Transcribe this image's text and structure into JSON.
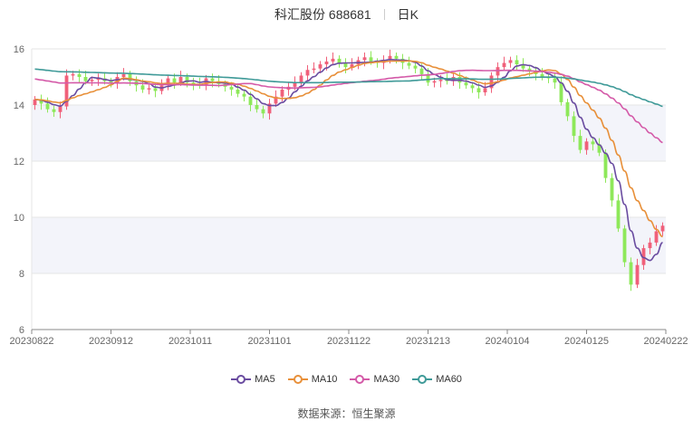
{
  "header": {
    "stock_name": "科汇股份 688681",
    "period_label": "日K"
  },
  "footer": {
    "source_label": "数据来源：",
    "source_name": "恒生聚源"
  },
  "chart_data": {
    "type": "candlestick",
    "ylim": [
      6,
      16
    ],
    "yticks": [
      6,
      8,
      10,
      12,
      14,
      16
    ],
    "xtick_labels": [
      "20230822",
      "20230912",
      "20231011",
      "20231101",
      "20231122",
      "20231213",
      "20240104",
      "20240125",
      "20240222"
    ],
    "up_color": "#f0607a",
    "down_color": "#8ee85a",
    "closes": [
      14.2,
      14.05,
      13.85,
      13.75,
      13.95,
      15.05,
      15.1,
      15.0,
      14.85,
      14.9,
      14.95,
      14.85,
      14.8,
      15.0,
      15.1,
      14.85,
      14.7,
      14.55,
      14.6,
      14.5,
      14.7,
      14.95,
      14.8,
      15.0,
      14.8,
      14.75,
      14.7,
      14.95,
      14.85,
      14.75,
      14.65,
      14.55,
      14.4,
      14.3,
      14.0,
      13.85,
      13.7,
      14.05,
      14.3,
      14.55,
      14.65,
      14.8,
      15.05,
      15.25,
      15.3,
      15.45,
      15.55,
      15.65,
      15.5,
      15.35,
      15.45,
      15.6,
      15.7,
      15.55,
      15.5,
      15.6,
      15.75,
      15.65,
      15.5,
      15.4,
      15.3,
      15.1,
      14.8,
      14.85,
      14.9,
      14.85,
      15.0,
      14.8,
      14.7,
      14.6,
      14.45,
      14.6,
      15.05,
      15.35,
      15.5,
      15.6,
      15.45,
      15.3,
      15.2,
      15.1,
      15.0,
      14.95,
      14.8,
      14.1,
      13.6,
      12.9,
      12.4,
      12.7,
      12.6,
      12.3,
      11.4,
      10.6,
      9.6,
      8.4,
      7.6,
      8.3,
      8.9,
      9.1,
      9.5,
      9.7
    ],
    "series": [
      {
        "name": "MA5",
        "color": "#6a4ca0",
        "period": 5
      },
      {
        "name": "MA10",
        "color": "#e8903a",
        "period": 10
      },
      {
        "name": "MA30",
        "color": "#d45aa8",
        "period": 30,
        "start": 14.95
      },
      {
        "name": "MA60",
        "color": "#3f9a98",
        "period": 60,
        "start": 15.3
      }
    ]
  }
}
